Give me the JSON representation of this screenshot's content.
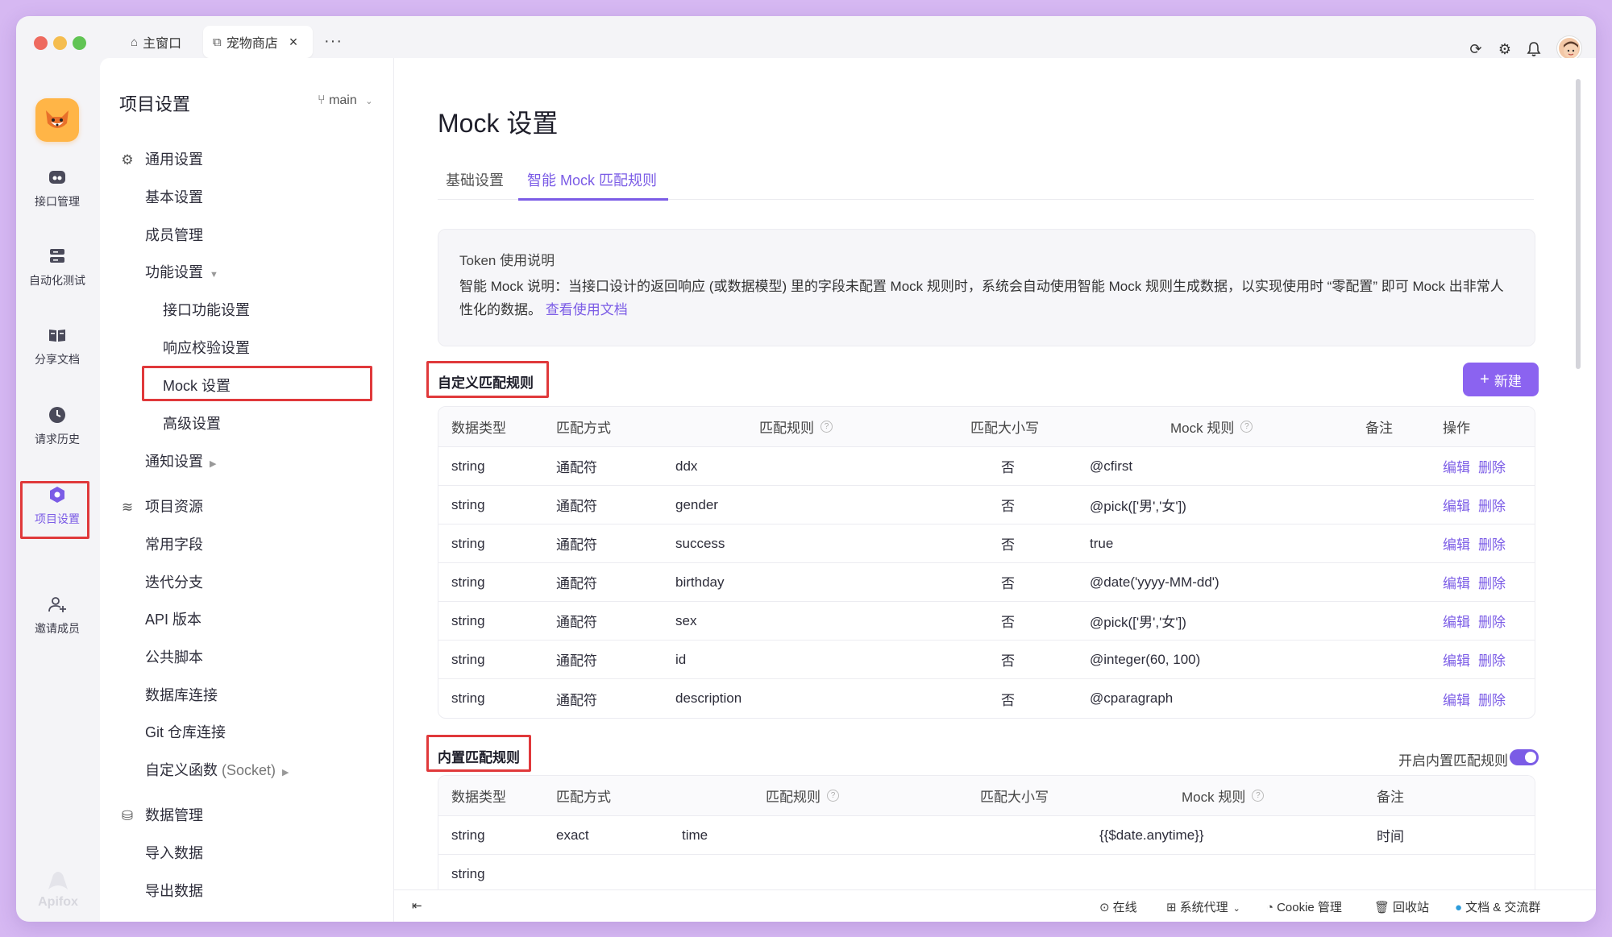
{
  "titlebar": {
    "tabs": [
      {
        "label": "主窗口",
        "icon": "home-icon"
      },
      {
        "label": "宠物商店",
        "icon": "external-link-icon"
      }
    ],
    "more": "···"
  },
  "rail": {
    "items": [
      {
        "label": "接口管理",
        "icon": "api-icon"
      },
      {
        "label": "自动化测试",
        "icon": "stack-icon"
      },
      {
        "label": "分享文档",
        "icon": "book-icon"
      },
      {
        "label": "请求历史",
        "icon": "clock-icon"
      },
      {
        "label": "项目设置",
        "icon": "hexagon-icon",
        "active": true
      },
      {
        "label": "邀请成员",
        "icon": "add-user-icon"
      }
    ],
    "brand": "Apifox"
  },
  "panel": {
    "title": "项目设置",
    "branch": "main",
    "groups": {
      "general": "通用设置",
      "basic": "基本设置",
      "members": "成员管理",
      "features": "功能设置",
      "api_features": "接口功能设置",
      "response_check": "响应校验设置",
      "mock": "Mock 设置",
      "advanced": "高级设置",
      "notify": "通知设置",
      "resources": "项目资源",
      "common_fields": "常用字段",
      "iteration": "迭代分支",
      "api_version": "API 版本",
      "public_script": "公共脚本",
      "db_conn": "数据库连接",
      "git_conn": "Git 仓库连接",
      "custom_func": "自定义函数",
      "custom_func_sub": "(Socket)",
      "data_mgmt": "数据管理",
      "import": "导入数据",
      "export": "导出数据"
    }
  },
  "main": {
    "title": "Mock 设置",
    "tabs": [
      "基础设置",
      "智能 Mock 匹配规则"
    ],
    "notice": {
      "title": "Token 使用说明",
      "body": "智能 Mock 说明：当接口设计的返回响应 (或数据模型) 里的字段未配置 Mock 规则时，系统会自动使用智能 Mock 规则生成数据，以实现使用时 “零配置” 即可 Mock 出非常人性化的数据。",
      "link": "查看使用文档"
    },
    "custom": {
      "title": "自定义匹配规则",
      "new_button": "新建",
      "headers": [
        "数据类型",
        "匹配方式",
        "匹配规则",
        "匹配大小写",
        "Mock 规则",
        "备注",
        "操作"
      ],
      "rows": [
        {
          "type": "string",
          "mode": "通配符",
          "rule": "ddx",
          "case": "否",
          "mock": "@cfirst",
          "note": ""
        },
        {
          "type": "string",
          "mode": "通配符",
          "rule": "gender",
          "case": "否",
          "mock": "@pick(['男','女'])",
          "note": ""
        },
        {
          "type": "string",
          "mode": "通配符",
          "rule": "success",
          "case": "否",
          "mock": "true",
          "note": ""
        },
        {
          "type": "string",
          "mode": "通配符",
          "rule": "birthday",
          "case": "否",
          "mock": "@date('yyyy-MM-dd')",
          "note": ""
        },
        {
          "type": "string",
          "mode": "通配符",
          "rule": "sex",
          "case": "否",
          "mock": "@pick(['男','女'])",
          "note": ""
        },
        {
          "type": "string",
          "mode": "通配符",
          "rule": "id",
          "case": "否",
          "mock": "@integer(60, 100)",
          "note": ""
        },
        {
          "type": "string",
          "mode": "通配符",
          "rule": "description",
          "case": "否",
          "mock": "@cparagraph",
          "note": ""
        }
      ],
      "edit": "编辑",
      "delete": "删除"
    },
    "builtin": {
      "title": "内置匹配规则",
      "toggle_label": "开启内置匹配规则",
      "toggle_on": true,
      "headers": [
        "数据类型",
        "匹配方式",
        "匹配规则",
        "匹配大小写",
        "Mock 规则",
        "备注"
      ],
      "rows": [
        {
          "type": "string",
          "mode": "exact",
          "rule": "time",
          "case": "",
          "mock": "{{$date.anytime}}",
          "note": "时间"
        },
        {
          "type": "string",
          "mode": "",
          "rule": "",
          "case": "",
          "mock": "",
          "note": ""
        }
      ]
    }
  },
  "footer": {
    "online": "在线",
    "proxy": "系统代理",
    "cookie": "Cookie 管理",
    "trash": "回收站",
    "docs": "文档 & 交流群"
  },
  "colors": {
    "accent": "#7b5ce6",
    "highlight_box": "#e0393b",
    "background": "#d6b8f2"
  }
}
